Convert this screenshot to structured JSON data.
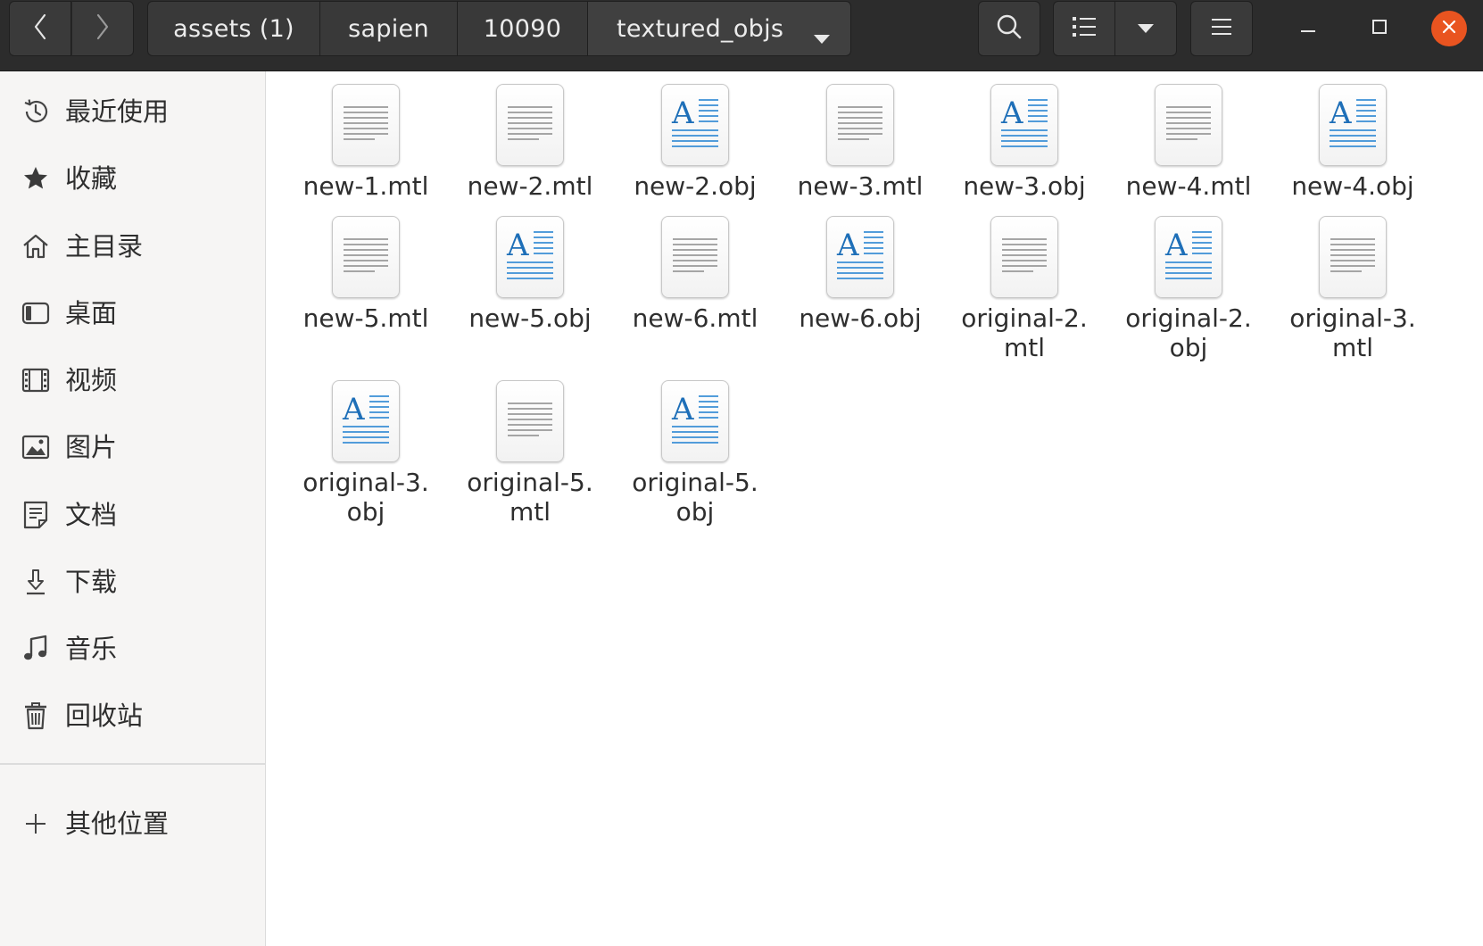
{
  "header": {
    "breadcrumbs": [
      "assets (1)",
      "sapien",
      "10090",
      "textured_objs"
    ],
    "icons": {
      "back": "chevron-left-icon",
      "forward": "chevron-right-icon",
      "breadcrumb_menu": "triangle-down-icon",
      "search": "search-icon",
      "view": "list-view-icon",
      "view_menu": "triangle-down-icon",
      "menu": "hamburger-menu-icon",
      "minimize": "minimize-icon",
      "maximize": "maximize-icon",
      "close": "close-icon"
    },
    "close_color": "#e95420"
  },
  "sidebar": {
    "items": [
      {
        "label": "最近使用",
        "icon": "clock-icon"
      },
      {
        "label": "收藏",
        "icon": "star-icon"
      },
      {
        "label": "主目录",
        "icon": "home-icon"
      },
      {
        "label": "桌面",
        "icon": "desktop-icon"
      },
      {
        "label": "视频",
        "icon": "film-icon"
      },
      {
        "label": "图片",
        "icon": "image-icon"
      },
      {
        "label": "文档",
        "icon": "document-icon"
      },
      {
        "label": "下载",
        "icon": "download-icon"
      },
      {
        "label": "音乐",
        "icon": "music-note-icon"
      },
      {
        "label": "回收站",
        "icon": "trash-icon"
      }
    ],
    "other_locations": {
      "label": "其他位置",
      "icon": "plus-icon"
    }
  },
  "files": [
    {
      "name": "new-1.mtl",
      "type": "text"
    },
    {
      "name": "new-2.mtl",
      "type": "text"
    },
    {
      "name": "new-2.obj",
      "type": "document"
    },
    {
      "name": "new-3.mtl",
      "type": "text"
    },
    {
      "name": "new-3.obj",
      "type": "document"
    },
    {
      "name": "new-4.mtl",
      "type": "text"
    },
    {
      "name": "new-4.obj",
      "type": "document"
    },
    {
      "name": "new-5.mtl",
      "type": "text"
    },
    {
      "name": "new-5.obj",
      "type": "document"
    },
    {
      "name": "new-6.mtl",
      "type": "text"
    },
    {
      "name": "new-6.obj",
      "type": "document"
    },
    {
      "name": "original-2.\nmtl",
      "type": "text"
    },
    {
      "name": "original-2.\nobj",
      "type": "document"
    },
    {
      "name": "original-3.\nmtl",
      "type": "text"
    },
    {
      "name": "original-3.\nobj",
      "type": "document"
    },
    {
      "name": "original-5.\nmtl",
      "type": "text"
    },
    {
      "name": "original-5.\nobj",
      "type": "document"
    }
  ],
  "colors": {
    "headerbar": "#2c2c2c",
    "sidebar": "#f6f5f4",
    "document_accent": "#1e6fb8"
  }
}
